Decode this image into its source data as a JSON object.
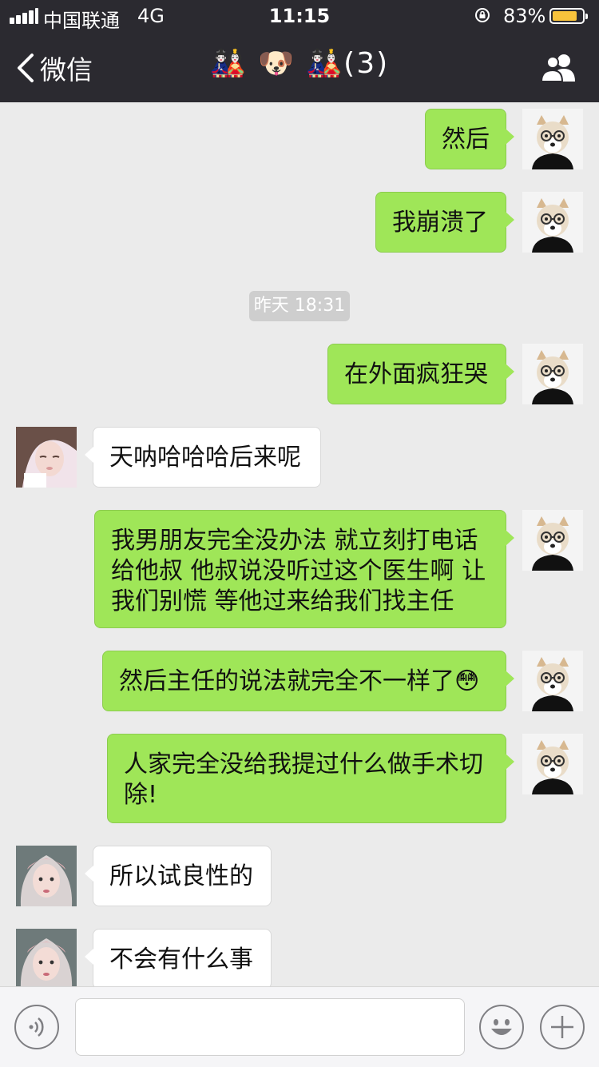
{
  "status_bar": {
    "carrier": "中国联通",
    "network": "4G",
    "time": "11:15",
    "battery_percent": "83%",
    "battery_level": 0.83
  },
  "nav": {
    "back_label": "微信",
    "title": "🎎 🐶 🎎(3)"
  },
  "chat": {
    "timestamp": "昨天 18:31",
    "messages": [
      {
        "sender": "me",
        "text": "然后"
      },
      {
        "sender": "me",
        "text": "我崩溃了"
      },
      {
        "sender": "me",
        "text": "在外面疯狂哭"
      },
      {
        "sender": "them",
        "text": "天呐哈哈哈后来呢"
      },
      {
        "sender": "me",
        "text": "我男朋友完全没办法 就立刻打电话给他叔 他叔说没听过这个医生啊 让我们别慌 等他过来给我们找主任"
      },
      {
        "sender": "me",
        "text": "然后主任的说法就完全不一样了😳"
      },
      {
        "sender": "me",
        "text": "人家完全没给我提过什么做手术切除!"
      },
      {
        "sender": "them",
        "text": "所以试良性的"
      },
      {
        "sender": "them",
        "text": "不会有什么事"
      }
    ]
  },
  "input_bar": {
    "icons": [
      "voice-icon",
      "emoji-icon",
      "plus-icon"
    ]
  },
  "colors": {
    "header_bg": "#2b2a30",
    "chat_bg": "#ebebeb",
    "my_bubble": "#9fe658",
    "their_bubble": "#ffffff"
  }
}
